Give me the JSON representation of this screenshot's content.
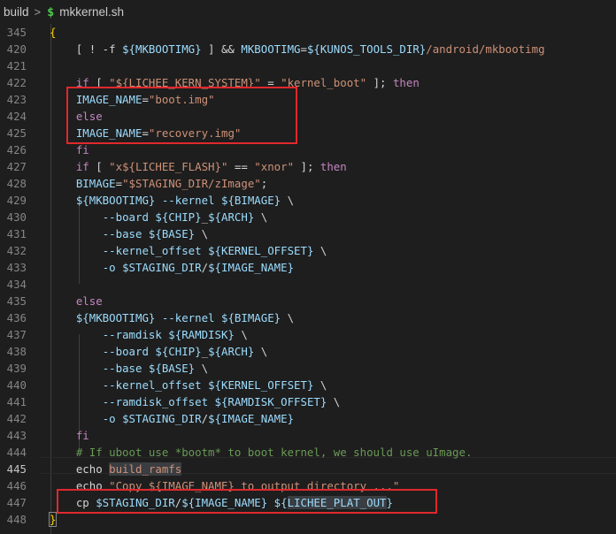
{
  "breadcrumb": {
    "folder": "build",
    "separator": ">",
    "file_icon": "$",
    "file": "mkkernel.sh"
  },
  "current_line": "445",
  "colors": {
    "background": "#1e1e1e",
    "highlight_box": "#e0282c"
  },
  "lines": [
    {
      "num": "345",
      "tokens": [
        [
          "brace",
          "{"
        ]
      ]
    },
    {
      "num": "420",
      "tokens": [
        [
          "pl",
          "    [ ! -f "
        ],
        [
          "var",
          "${MKBOOTIMG}"
        ],
        [
          "pl",
          " ] && "
        ],
        [
          "var",
          "MKBOOTIMG"
        ],
        [
          "pl",
          "="
        ],
        [
          "var",
          "${KUNOS_TOOLS_DIR}"
        ],
        [
          "str",
          "/android/mkbootimg"
        ]
      ]
    },
    {
      "num": "421",
      "tokens": []
    },
    {
      "num": "422",
      "tokens": [
        [
          "pl",
          "    "
        ],
        [
          "kw",
          "if"
        ],
        [
          "pl",
          " [ "
        ],
        [
          "str",
          "\"${LICHEE_KERN_SYSTEM}\""
        ],
        [
          "pl",
          " = "
        ],
        [
          "str",
          "\"kernel_boot\""
        ],
        [
          "pl",
          " ]; "
        ],
        [
          "kw",
          "then"
        ]
      ]
    },
    {
      "num": "423",
      "tokens": [
        [
          "pl",
          "    "
        ],
        [
          "var",
          "IMAGE_NAME"
        ],
        [
          "pl",
          "="
        ],
        [
          "str",
          "\"boot.img\""
        ]
      ]
    },
    {
      "num": "424",
      "tokens": [
        [
          "pl",
          "    "
        ],
        [
          "kw",
          "else"
        ]
      ]
    },
    {
      "num": "425",
      "tokens": [
        [
          "pl",
          "    "
        ],
        [
          "var",
          "IMAGE_NAME"
        ],
        [
          "pl",
          "="
        ],
        [
          "str",
          "\"recovery.img\""
        ]
      ]
    },
    {
      "num": "426",
      "tokens": [
        [
          "pl",
          "    "
        ],
        [
          "kw",
          "fi"
        ]
      ]
    },
    {
      "num": "427",
      "tokens": [
        [
          "pl",
          "    "
        ],
        [
          "kw",
          "if"
        ],
        [
          "pl",
          " [ "
        ],
        [
          "str",
          "\"x${LICHEE_FLASH}\""
        ],
        [
          "pl",
          " == "
        ],
        [
          "str",
          "\"xnor\""
        ],
        [
          "pl",
          " ]; "
        ],
        [
          "kw",
          "then"
        ]
      ]
    },
    {
      "num": "428",
      "tokens": [
        [
          "pl",
          "    "
        ],
        [
          "var",
          "BIMAGE"
        ],
        [
          "pl",
          "="
        ],
        [
          "str",
          "\"$STAGING_DIR/zImage\""
        ],
        [
          "pl",
          ";"
        ]
      ]
    },
    {
      "num": "429",
      "tokens": [
        [
          "pl",
          "    "
        ],
        [
          "var",
          "${MKBOOTIMG}"
        ],
        [
          "pl",
          " "
        ],
        [
          "var",
          "--kernel"
        ],
        [
          "pl",
          " "
        ],
        [
          "var",
          "${BIMAGE}"
        ],
        [
          "pl",
          " \\"
        ]
      ]
    },
    {
      "num": "430",
      "tokens": [
        [
          "pl",
          "        "
        ],
        [
          "var",
          "--board"
        ],
        [
          "pl",
          " "
        ],
        [
          "var",
          "${CHIP}"
        ],
        [
          "pl",
          "_"
        ],
        [
          "var",
          "${ARCH}"
        ],
        [
          "pl",
          " \\"
        ]
      ]
    },
    {
      "num": "431",
      "tokens": [
        [
          "pl",
          "        "
        ],
        [
          "var",
          "--base"
        ],
        [
          "pl",
          " "
        ],
        [
          "var",
          "${BASE}"
        ],
        [
          "pl",
          " \\"
        ]
      ]
    },
    {
      "num": "432",
      "tokens": [
        [
          "pl",
          "        "
        ],
        [
          "var",
          "--kernel_offset"
        ],
        [
          "pl",
          " "
        ],
        [
          "var",
          "${KERNEL_OFFSET}"
        ],
        [
          "pl",
          " \\"
        ]
      ]
    },
    {
      "num": "433",
      "tokens": [
        [
          "pl",
          "        "
        ],
        [
          "var",
          "-o"
        ],
        [
          "pl",
          " "
        ],
        [
          "var",
          "$STAGING_DIR"
        ],
        [
          "pl",
          "/"
        ],
        [
          "var",
          "${IMAGE_NAME}"
        ]
      ]
    },
    {
      "num": "434",
      "tokens": []
    },
    {
      "num": "435",
      "tokens": [
        [
          "pl",
          "    "
        ],
        [
          "kw",
          "else"
        ]
      ]
    },
    {
      "num": "436",
      "tokens": [
        [
          "pl",
          "    "
        ],
        [
          "var",
          "${MKBOOTIMG}"
        ],
        [
          "pl",
          " "
        ],
        [
          "var",
          "--kernel"
        ],
        [
          "pl",
          " "
        ],
        [
          "var",
          "${BIMAGE}"
        ],
        [
          "pl",
          " \\"
        ]
      ]
    },
    {
      "num": "437",
      "tokens": [
        [
          "pl",
          "        "
        ],
        [
          "var",
          "--ramdisk"
        ],
        [
          "pl",
          " "
        ],
        [
          "var",
          "${RAMDISK}"
        ],
        [
          "pl",
          " \\"
        ]
      ]
    },
    {
      "num": "438",
      "tokens": [
        [
          "pl",
          "        "
        ],
        [
          "var",
          "--board"
        ],
        [
          "pl",
          " "
        ],
        [
          "var",
          "${CHIP}"
        ],
        [
          "pl",
          "_"
        ],
        [
          "var",
          "${ARCH}"
        ],
        [
          "pl",
          " \\"
        ]
      ]
    },
    {
      "num": "439",
      "tokens": [
        [
          "pl",
          "        "
        ],
        [
          "var",
          "--base"
        ],
        [
          "pl",
          " "
        ],
        [
          "var",
          "${BASE}"
        ],
        [
          "pl",
          " \\"
        ]
      ]
    },
    {
      "num": "440",
      "tokens": [
        [
          "pl",
          "        "
        ],
        [
          "var",
          "--kernel_offset"
        ],
        [
          "pl",
          " "
        ],
        [
          "var",
          "${KERNEL_OFFSET}"
        ],
        [
          "pl",
          " \\"
        ]
      ]
    },
    {
      "num": "441",
      "tokens": [
        [
          "pl",
          "        "
        ],
        [
          "var",
          "--ramdisk_offset"
        ],
        [
          "pl",
          " "
        ],
        [
          "var",
          "${RAMDISK_OFFSET}"
        ],
        [
          "pl",
          " \\"
        ]
      ]
    },
    {
      "num": "442",
      "tokens": [
        [
          "pl",
          "        "
        ],
        [
          "var",
          "-o"
        ],
        [
          "pl",
          " "
        ],
        [
          "var",
          "$STAGING_DIR"
        ],
        [
          "pl",
          "/"
        ],
        [
          "var",
          "${IMAGE_NAME}"
        ]
      ]
    },
    {
      "num": "443",
      "tokens": [
        [
          "pl",
          "    "
        ],
        [
          "kw",
          "fi"
        ]
      ]
    },
    {
      "num": "444",
      "tokens": [
        [
          "pl",
          "    "
        ],
        [
          "cmt",
          "# If uboot use *bootm* to boot kernel, we should use uImage."
        ]
      ]
    },
    {
      "num": "445",
      "tokens": [
        [
          "pl",
          "    echo "
        ],
        [
          "hl",
          "build_ramfs"
        ]
      ]
    },
    {
      "num": "446",
      "tokens": [
        [
          "pl",
          "    echo "
        ],
        [
          "str",
          "\"Copy ${IMAGE_NAME} to output directory ...\""
        ]
      ]
    },
    {
      "num": "447",
      "tokens": [
        [
          "pl",
          "    cp "
        ],
        [
          "var",
          "$STAGING_DIR"
        ],
        [
          "pl",
          "/"
        ],
        [
          "var",
          "${IMAGE_NAME}"
        ],
        [
          "pl",
          " "
        ],
        [
          "var",
          "${"
        ],
        [
          "hlvar",
          "LICHEE_PLAT_OUT"
        ],
        [
          "var",
          "}"
        ]
      ]
    },
    {
      "num": "448",
      "tokens": [
        [
          "bracketbox",
          "}"
        ]
      ]
    }
  ]
}
